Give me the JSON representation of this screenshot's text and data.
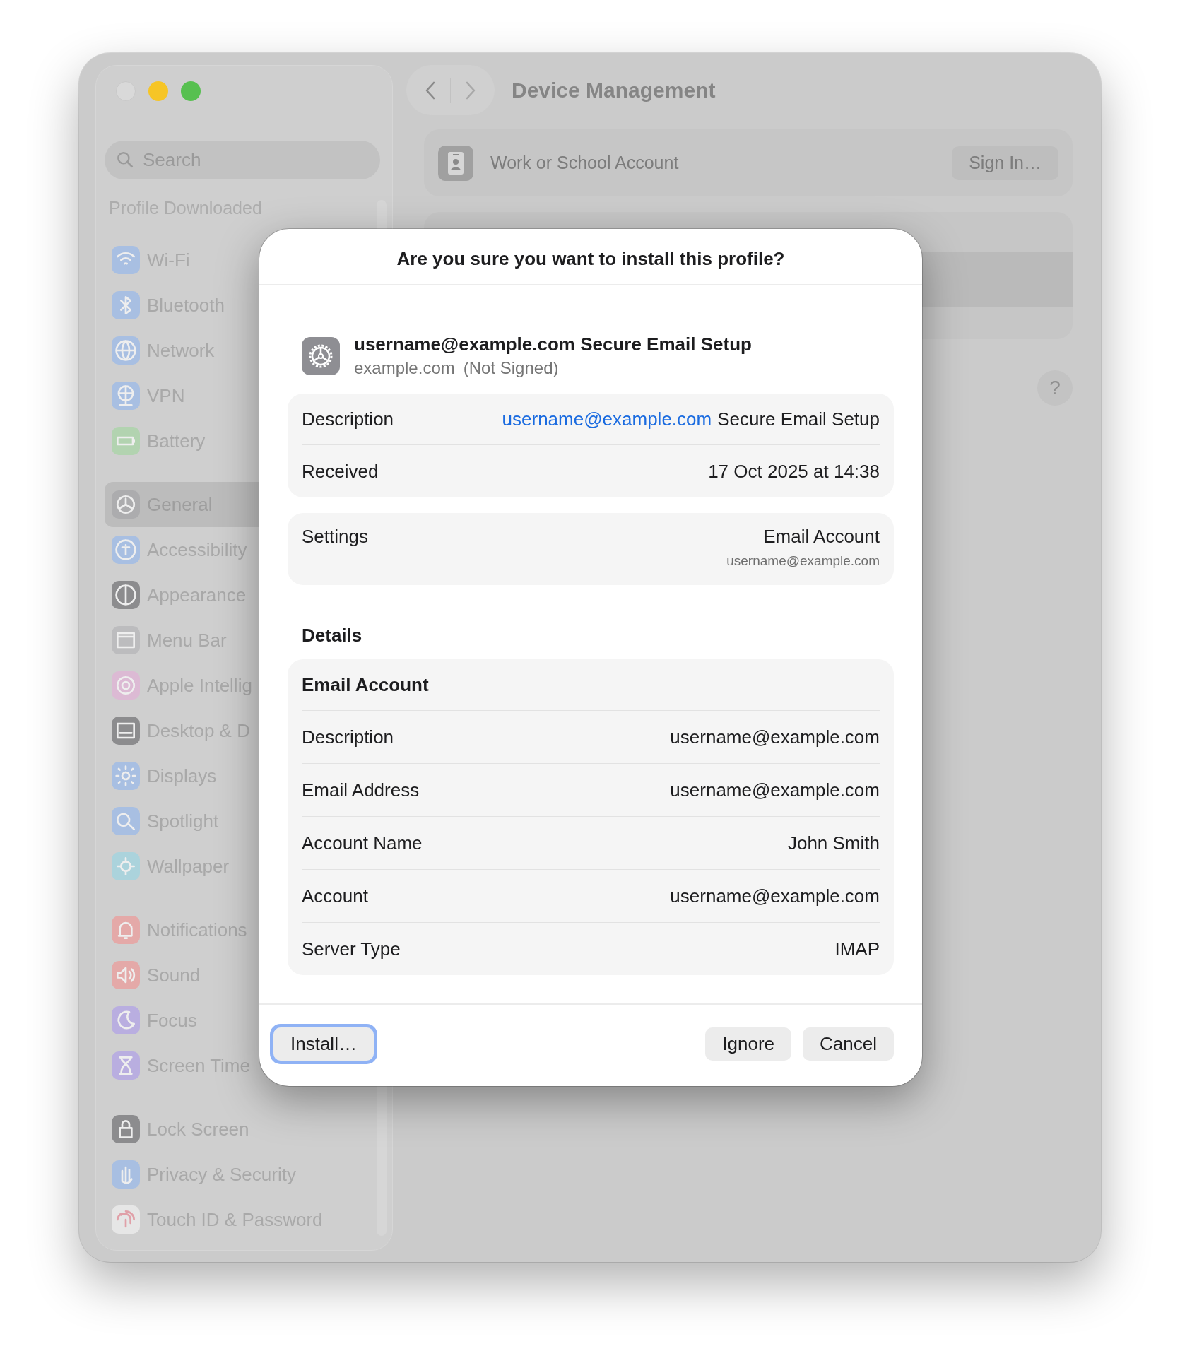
{
  "window": {
    "title": "Device Management"
  },
  "sidebar": {
    "search": {
      "placeholder": "Search"
    },
    "section_label": "Profile Downloaded",
    "groups": [
      [
        {
          "label": "Wi-Fi",
          "color": "#a8bfe2",
          "selected": false
        },
        {
          "label": "Bluetooth",
          "color": "#a8bfe2",
          "selected": false
        },
        {
          "label": "Network",
          "color": "#a8bfe2",
          "selected": false
        },
        {
          "label": "VPN",
          "color": "#a8bfe2",
          "selected": false
        },
        {
          "label": "Battery",
          "color": "#b2d3b0",
          "selected": false
        }
      ],
      [
        {
          "label": "General",
          "color": "#acacae",
          "selected": true
        },
        {
          "label": "Accessibility",
          "color": "#a8bfe2",
          "selected": false
        },
        {
          "label": "Appearance",
          "color": "#8c8c8e",
          "selected": false
        },
        {
          "label": "Menu Bar",
          "color": "#bcbcbe",
          "selected": false
        },
        {
          "label": "Apple Intellig",
          "color": "#dcbad4",
          "selected": false
        },
        {
          "label": "Desktop & D",
          "color": "#8c8c8e",
          "selected": false
        },
        {
          "label": "Displays",
          "color": "#a8bfe2",
          "selected": false
        },
        {
          "label": "Spotlight",
          "color": "#a8bfe2",
          "selected": false
        },
        {
          "label": "Wallpaper",
          "color": "#abd3dc",
          "selected": false
        }
      ],
      [
        {
          "label": "Notifications",
          "color": "#e4a9a8",
          "selected": false
        },
        {
          "label": "Sound",
          "color": "#e4a9a8",
          "selected": false
        },
        {
          "label": "Focus",
          "color": "#b9aee0",
          "selected": false
        },
        {
          "label": "Screen Time",
          "color": "#b9aee0",
          "selected": false
        }
      ],
      [
        {
          "label": "Lock Screen",
          "color": "#8c8c8e",
          "selected": false
        },
        {
          "label": "Privacy & Security",
          "color": "#a8bfe2",
          "selected": false
        },
        {
          "label": "Touch ID & Password",
          "color": "#e6e6e6",
          "selected": false
        }
      ]
    ]
  },
  "account_card": {
    "label": "Work or School Account",
    "button": "Sign In…"
  },
  "help_button": "?",
  "sheet": {
    "title": "Are you sure you want to install this profile?",
    "profile": {
      "name": "username@example.com Secure Email Setup",
      "domain": "example.com",
      "signing": "(Not Signed)"
    },
    "summary": [
      {
        "label": "Description",
        "link": "username@example.com",
        "value": "Secure Email Setup"
      },
      {
        "label": "Received",
        "value": "17 Oct 2025 at 14:38"
      }
    ],
    "settings": {
      "label": "Settings",
      "value": "Email Account",
      "sub": "username@example.com"
    },
    "details_heading": "Details",
    "details": {
      "title": "Email Account",
      "rows": [
        {
          "label": "Description",
          "value": "username@example.com"
        },
        {
          "label": "Email Address",
          "value": "username@example.com"
        },
        {
          "label": "Account Name",
          "value": "John Smith"
        },
        {
          "label": "Account",
          "value": "username@example.com"
        },
        {
          "label": "Server Type",
          "value": "IMAP"
        }
      ]
    },
    "buttons": [
      {
        "label": "Install…",
        "focused": true
      },
      {
        "label": "Ignore",
        "focused": false
      },
      {
        "label": "Cancel",
        "focused": false
      }
    ]
  }
}
